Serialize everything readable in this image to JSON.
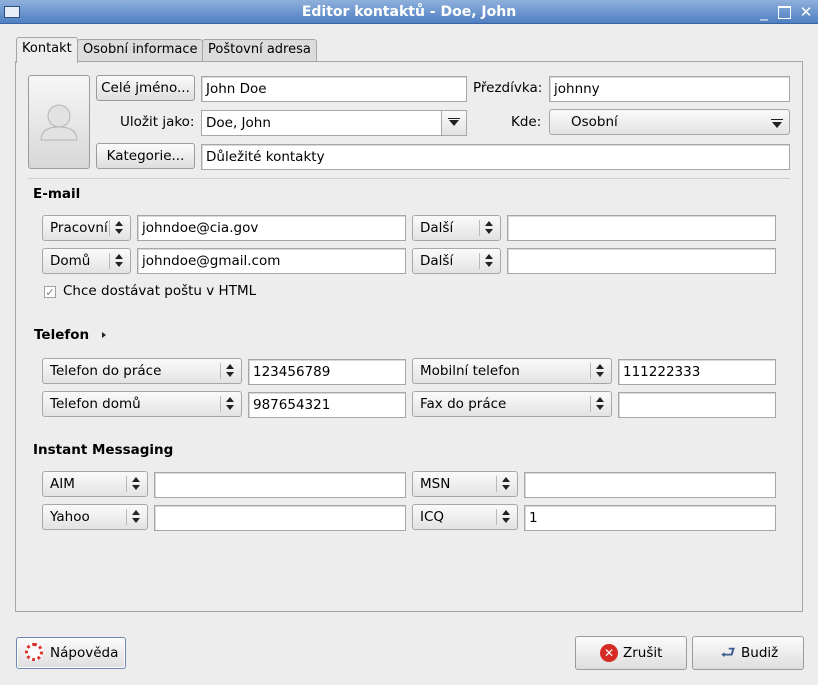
{
  "window": {
    "title": "Editor kontaktů - Doe, John"
  },
  "tabs": [
    "Kontakt",
    "Osobní informace",
    "Poštovní adresa"
  ],
  "identity": {
    "full_name_button": "Celé jméno...",
    "full_name_value": "John Doe",
    "nickname_label": "Přezdívka:",
    "nickname_value": "johnny",
    "file_as_label": "Uložit jako:",
    "file_as_value": "Doe, John",
    "where_label": "Kde:",
    "where_value": "Osobní",
    "categories_button": "Kategorie...",
    "categories_value": "Důležité kontakty"
  },
  "email": {
    "heading": "E-mail",
    "rows": [
      {
        "type": "Pracovní",
        "value": "johndoe@cia.gov",
        "type2": "Další",
        "value2": ""
      },
      {
        "type": "Domů",
        "value": "johndoe@gmail.com",
        "type2": "Další",
        "value2": ""
      }
    ],
    "html_checkbox_label": "Chce dostávat poštu v HTML",
    "html_checked": true
  },
  "phone": {
    "heading": "Telefon",
    "rows": [
      {
        "type": "Telefon do práce",
        "value": "123456789",
        "type2": "Mobilní telefon",
        "value2": "111222333"
      },
      {
        "type": "Telefon domů",
        "value": "987654321",
        "type2": "Fax do práce",
        "value2": ""
      }
    ]
  },
  "im": {
    "heading": "Instant Messaging",
    "rows": [
      {
        "type": "AIM",
        "value": "",
        "type2": "MSN",
        "value2": ""
      },
      {
        "type": "Yahoo",
        "value": "",
        "type2": "ICQ",
        "value2": "1"
      }
    ]
  },
  "buttons": {
    "help": "Nápověda",
    "cancel": "Zrušit",
    "ok": "Budiž"
  },
  "icons": {
    "window": "window-menu-icon",
    "photo": "contact-photo-placeholder-icon",
    "help": "lifebuoy-icon",
    "cancel": "cancel-icon",
    "ok": "ok-arrow-icon"
  }
}
